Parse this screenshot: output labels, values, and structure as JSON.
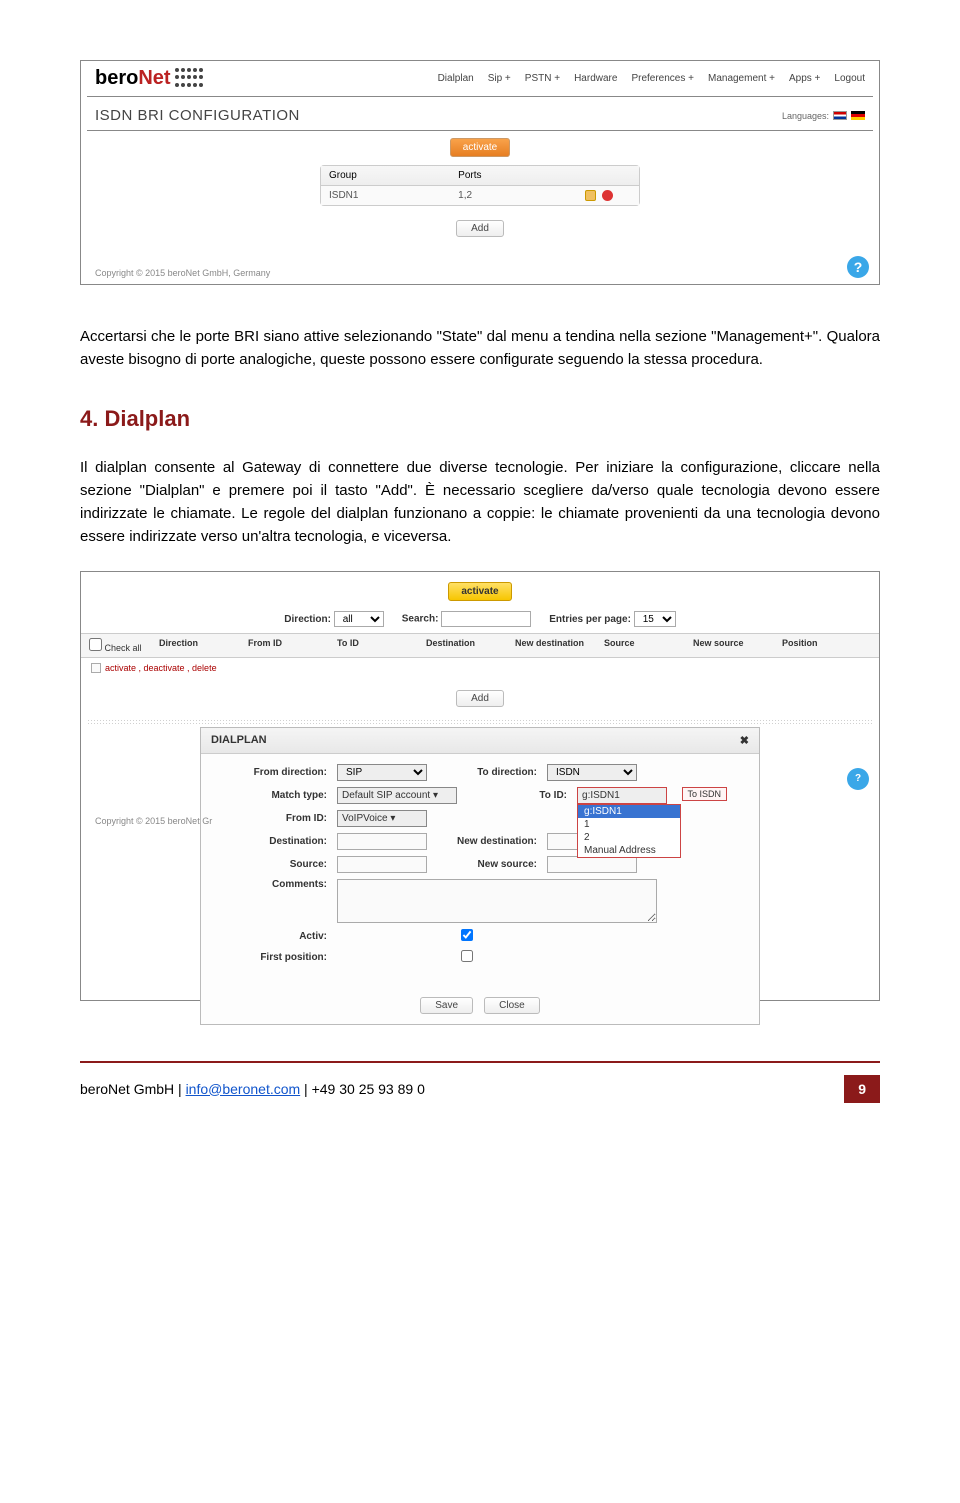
{
  "shot1": {
    "logo": {
      "part1": "bero",
      "part2": "Net"
    },
    "menu": [
      "Dialplan",
      "Sip +",
      "PSTN +",
      "Hardware",
      "Preferences +",
      "Management +",
      "Apps +",
      "Logout"
    ],
    "title": "ISDN BRI CONFIGURATION",
    "languages_label": "Languages:",
    "activate": "activate",
    "th_group": "Group",
    "th_ports": "Ports",
    "td_group": "ISDN1",
    "td_ports": "1,2",
    "add": "Add",
    "copyright": "Copyright © 2015 beroNet GmbH, Germany"
  },
  "text": {
    "p1": "Accertarsi che le porte BRI siano attive selezionando \"State\" dal menu a tendina nella sezione \"Management+\". Qualora aveste bisogno di porte analogiche, queste possono essere configurate seguendo la stessa procedura.",
    "h2": "4. Dialplan",
    "p2": "Il dialplan consente al Gateway di connettere due diverse tecnologie. Per iniziare la configurazione, cliccare nella sezione \"Dialplan\" e premere poi il tasto \"Add\". È necessario scegliere da/verso quale tecnologia devono essere  indirizzate le chiamate. Le regole del dialplan funzionano a coppie: le chiamate provenienti da una tecnologia devono essere indirizzate verso un'altra tecnologia, e viceversa."
  },
  "shot2": {
    "activate": "activate",
    "direction_label": "Direction:",
    "direction_val": "all",
    "search_label": "Search:",
    "entries_label": "Entries per page:",
    "entries_val": "15",
    "headers": [
      "Check all",
      "Direction",
      "From ID",
      "To ID",
      "Destination",
      "New destination",
      "Source",
      "New source",
      "Position"
    ],
    "row_actions": "activate , deactivate , delete",
    "add": "Add",
    "dialog_title": "DIALPLAN",
    "from_direction": "From direction:",
    "from_direction_val": "SIP",
    "to_direction": "To direction:",
    "to_direction_val": "ISDN",
    "match_type": "Match type:",
    "match_type_val": "Default SIP account ▾",
    "to_id": "To ID:",
    "to_id_val": "g:ISDN1",
    "to_id_options": [
      "g:ISDN1",
      "1",
      "2",
      "Manual Address"
    ],
    "to_id_note": "To ISDN",
    "from_id": "From ID:",
    "from_id_val": "VoIPVoice ▾",
    "destination": "Destination:",
    "new_destination": "New destination:",
    "source": "Source:",
    "new_source": "New source:",
    "comments": "Comments:",
    "activ": "Activ:",
    "first_position": "First position:",
    "save": "Save",
    "close": "Close",
    "copyright": "Copyright © 2015 beroNet Gr"
  },
  "footer": {
    "company": "beroNet GmbH | ",
    "email": "info@beronet.com",
    "phone": " | +49 30 25 93 89 0",
    "page": "9"
  }
}
